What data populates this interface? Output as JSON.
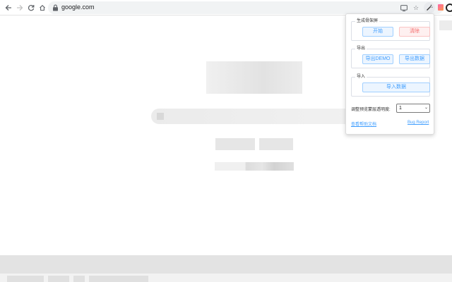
{
  "browser": {
    "url": "google.com",
    "icons": {
      "back": "arrow-left-icon",
      "forward": "arrow-right-icon",
      "reload": "reload-icon",
      "home": "home-icon",
      "lock": "lock-icon",
      "cast": "cast-icon",
      "bookmark": "star-icon",
      "extension": "magic-wand-icon",
      "profile": "profile-icon"
    }
  },
  "popup": {
    "skeleton_section": {
      "legend": "生成骨架屏",
      "start_label": "开始",
      "clear_label": "清除"
    },
    "export_section": {
      "legend": "导出",
      "export_demo_label": "导出DEMO",
      "export_data_label": "导出数据"
    },
    "import_section": {
      "legend": "导入",
      "import_data_label": "导入数据"
    },
    "opacity": {
      "label": "调整预览蒙层透明度:",
      "selected_value": "1"
    },
    "links": {
      "help_docs": "查看帮助文档",
      "bug_report": "Bug Report"
    },
    "colors": {
      "primary": "#409eff",
      "primary_bg": "#ecf5ff",
      "danger": "#f56c6c",
      "danger_bg": "#fef0f0"
    }
  }
}
